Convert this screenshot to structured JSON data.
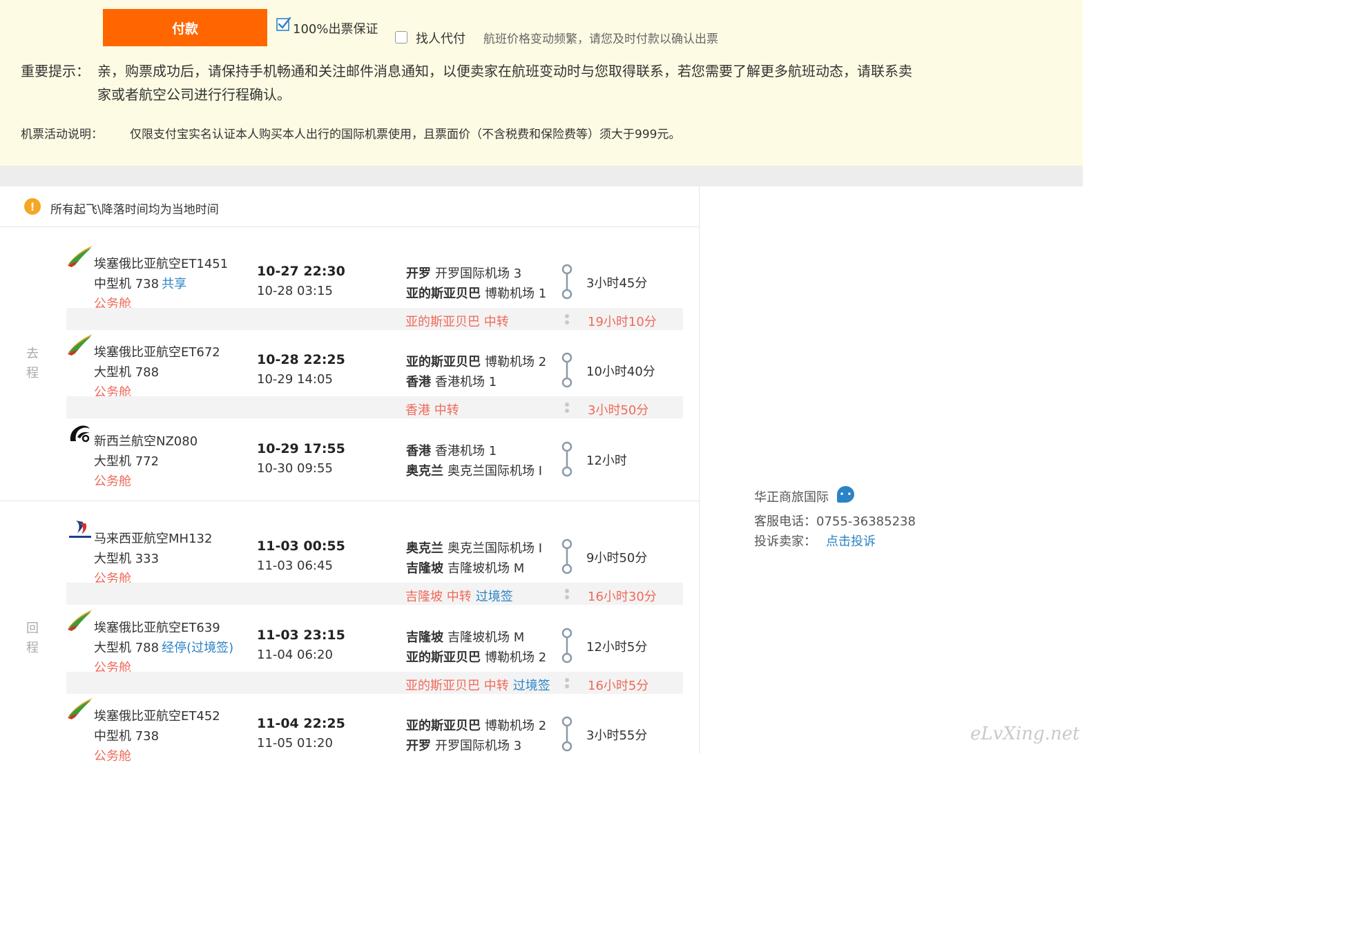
{
  "payment": {
    "pay_label": "付款",
    "guarantee_label": "100%出票保证",
    "proxy_pay_label": "找人代付",
    "price_note": "航班价格变动频繁，请您及时付款以确认出票"
  },
  "notice": {
    "label": "重要提示：",
    "line1": "亲，购票成功后，请保持手机畅通和关注邮件消息通知，以便卖家在航班变动时与您取得联系，若您需要了解更多航班动态，请联系卖",
    "line2": "家或者航空公司进行行程确认。"
  },
  "promo": {
    "label": "机票活动说明：",
    "text": "仅限支付宝实名认证本人购买本人出行的国际机票使用，且票面价（不含税费和保险费等）须大于999元。"
  },
  "time_note": "所有起飞\\降落时间均为当地时间",
  "outbound": {
    "label_1": "去",
    "label_2": "程",
    "segments": [
      {
        "airline": "埃塞俄比亚航空ET1451",
        "plane": "中型机 738",
        "plane_extra": "共享",
        "cabin": "公务舱",
        "dep_time": "10-27 22:30",
        "arr_time": "10-28 03:15",
        "dep_city": "开罗",
        "dep_airport": "开罗国际机场 3",
        "arr_city": "亚的斯亚贝巴",
        "arr_airport": "博勒机场 1",
        "duration": "3小时45分",
        "logo": "ethiopian-logo"
      },
      {
        "airline": "埃塞俄比亚航空ET672",
        "plane": "大型机 788",
        "plane_extra": "",
        "cabin": "公务舱",
        "dep_time": "10-28 22:25",
        "arr_time": "10-29 14:05",
        "dep_city": "亚的斯亚贝巴",
        "dep_airport": "博勒机场 2",
        "arr_city": "香港",
        "arr_airport": "香港机场 1",
        "duration": "10小时40分",
        "logo": "ethiopian-logo"
      },
      {
        "airline": "新西兰航空NZ080",
        "plane": "大型机 772",
        "plane_extra": "",
        "cabin": "公务舱",
        "dep_time": "10-29 17:55",
        "arr_time": "10-30 09:55",
        "dep_city": "香港",
        "dep_airport": "香港机场 1",
        "arr_city": "奥克兰",
        "arr_airport": "奥克兰国际机场 I",
        "duration": "12小时",
        "logo": "air-new-zealand-logo"
      }
    ],
    "transfers": [
      {
        "city": "亚的斯亚贝巴",
        "type": "中转",
        "extra": "",
        "wait": "19小时10分"
      },
      {
        "city": "香港",
        "type": "中转",
        "extra": "",
        "wait": "3小时50分"
      }
    ]
  },
  "return": {
    "label_1": "回",
    "label_2": "程",
    "segments": [
      {
        "airline": "马来西亚航空MH132",
        "plane": "大型机 333",
        "plane_extra": "",
        "cabin": "公务舱",
        "dep_time": "11-03 00:55",
        "arr_time": "11-03 06:45",
        "dep_city": "奥克兰",
        "dep_airport": "奥克兰国际机场 I",
        "arr_city": "吉隆坡",
        "arr_airport": "吉隆坡机场 M",
        "duration": "9小时50分",
        "logo": "malaysia-airlines-logo"
      },
      {
        "airline": "埃塞俄比亚航空ET639",
        "plane": "大型机 788",
        "plane_extra": "经停(过境签)",
        "cabin": "公务舱",
        "dep_time": "11-03 23:15",
        "arr_time": "11-04 06:20",
        "dep_city": "吉隆坡",
        "dep_airport": "吉隆坡机场 M",
        "arr_city": "亚的斯亚贝巴",
        "arr_airport": "博勒机场 2",
        "duration": "12小时5分",
        "logo": "ethiopian-logo"
      },
      {
        "airline": "埃塞俄比亚航空ET452",
        "plane": "中型机 738",
        "plane_extra": "",
        "cabin": "公务舱",
        "dep_time": "11-04 22:25",
        "arr_time": "11-05 01:20",
        "dep_city": "亚的斯亚贝巴",
        "dep_airport": "博勒机场 2",
        "arr_city": "开罗",
        "arr_airport": "开罗国际机场 3",
        "duration": "3小时55分",
        "logo": "ethiopian-logo"
      }
    ],
    "transfers": [
      {
        "city": "吉隆坡",
        "type": "中转",
        "extra": "过境签",
        "wait": "16小时30分"
      },
      {
        "city": "亚的斯亚贝巴",
        "type": "中转",
        "extra": "过境签",
        "wait": "16小时5分"
      }
    ]
  },
  "seller": {
    "name": "华正商旅国际",
    "phone": "客服电话：0755-36385238",
    "complain_label": "投诉卖家：",
    "complain_link": "点击投诉"
  },
  "watermark": "eLvXing.net",
  "colors": {
    "pay_button": "#ff6600",
    "banner_bg": "#fdfbe3",
    "accent_link": "#2a83c6",
    "cabin_red": "#f06a5a",
    "transfer_bg": "#f3f3f3"
  }
}
